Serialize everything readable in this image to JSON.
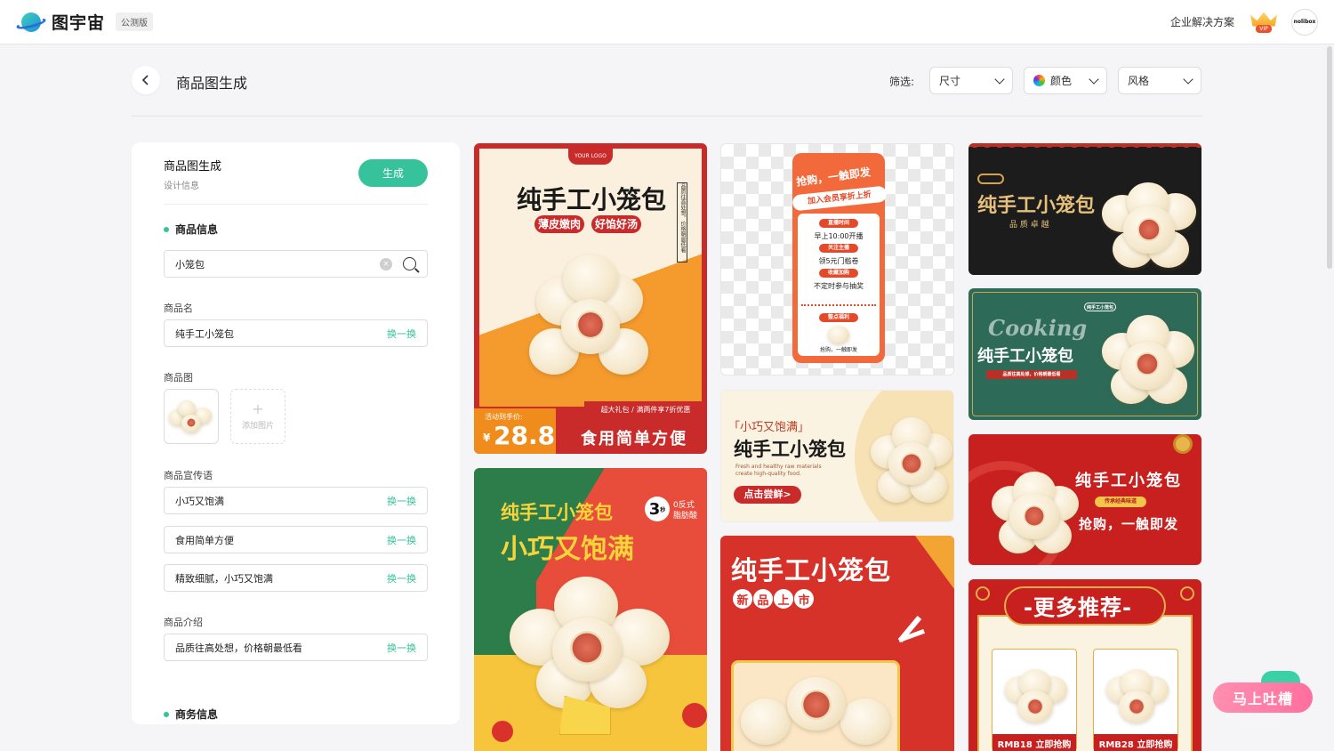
{
  "header": {
    "logo_text": "图宇宙",
    "beta_badge": "公测版",
    "enterprise_link": "企业解决方案",
    "vip_badge": "VIP",
    "avatar_text": "nolibox"
  },
  "page": {
    "title": "商品图生成",
    "filter_label": "筛选:",
    "filters": [
      "尺寸",
      "颜色",
      "风格"
    ]
  },
  "panel": {
    "title": "商品图生成",
    "subtitle": "设计信息",
    "generate_label": "生成",
    "product_info_heading": "商品信息",
    "search_value": "小笼包",
    "name_label": "商品名",
    "name_value": "纯手工小笼包",
    "swap_label": "换一换",
    "image_label": "商品图",
    "add_image_label": "添加图片",
    "slogan_label": "商品宣传语",
    "slogans": [
      "小巧又饱满",
      "食用简单方便",
      "精致细腻，小巧又饱满"
    ],
    "intro_label": "商品介绍",
    "intro_value": "品质往高处想，价格朝最低看",
    "business_heading": "商务信息"
  },
  "cards": {
    "c1": {
      "logo": "YOUR LOGO",
      "title": "纯手工小笼包",
      "tag1": "薄皮嫩肉",
      "tag2": "好馅好汤",
      "side_text": "品质往高处想，价格朝最低看",
      "promo": "超大礼包 / 满两件享7折优惠",
      "price_label": "活动到手价:",
      "price_symbol": "¥",
      "price": "28.8",
      "slogan": "食用简单方便"
    },
    "c2": {
      "title": "纯手工小笼包",
      "subtitle": "小巧又饱满",
      "badge_num": "3",
      "badge_unit": "秒",
      "badge_text1": "0反式",
      "badge_text2": "脂肪酸"
    },
    "c3": {
      "headline": "抢购，一触即发",
      "member": "加入会员享折上折",
      "label1": "直播时间",
      "line1": "早上10:00开播",
      "label2": "关注主播",
      "line2": "领5元门槛卷",
      "label3": "收藏加购",
      "line3": "不定时参与抽奖",
      "label4": "整点福利",
      "footer": "抢购，一触即发"
    },
    "c4": {
      "quote": "「小巧又饱满」",
      "title": "纯手工小笼包",
      "en1": "Fresh and healthy raw materials",
      "en2": "create high-quality food.",
      "cta": "点击尝鲜>"
    },
    "c5": {
      "title": "纯手工小笼包",
      "tag": "新品上市",
      "tag_chars": [
        "新",
        "品",
        "上",
        "市"
      ]
    },
    "c6": {
      "title": "纯手工小笼包",
      "sub": "品 质 卓 越"
    },
    "c7": {
      "script": "Cooking",
      "title": "纯手工小笼包",
      "top_tag": "纯手工小笼包",
      "bottom_tag": "品质往高处想，价格朝最低看"
    },
    "c8": {
      "title": "纯手工小笼包",
      "tag": "传承经典味道",
      "slogan": "抢购，一触即发"
    },
    "c9": {
      "title": "-更多推荐-",
      "item1": "RMB18 立即抢购",
      "item2": "RMB28 立即抢购"
    }
  },
  "feedback_label": "马上吐槽"
}
